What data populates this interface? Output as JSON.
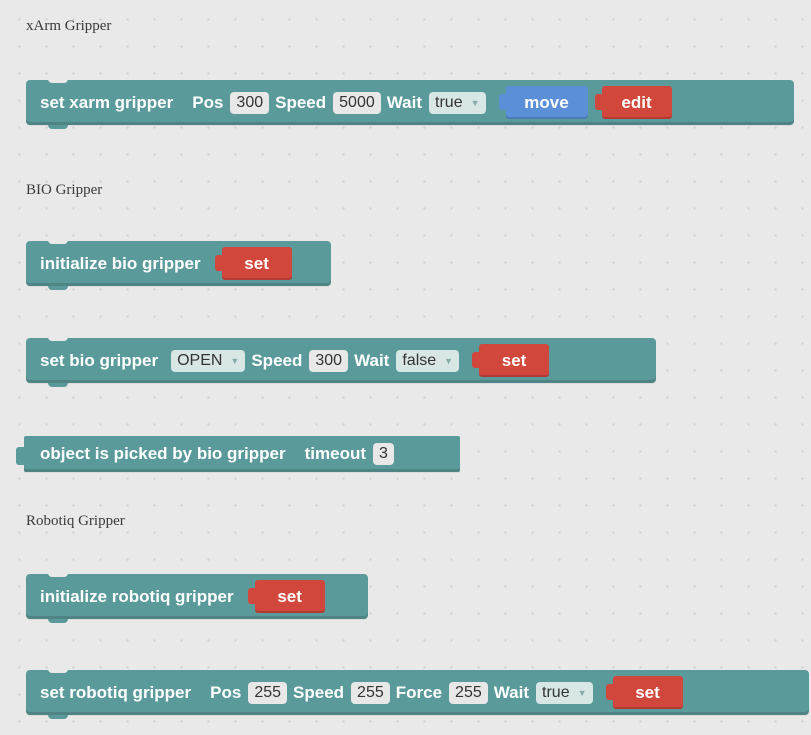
{
  "sections": {
    "xarm": "xArm Gripper",
    "bio": "BIO Gripper",
    "robotiq": "Robotiq Gripper"
  },
  "xarm_block": {
    "label": "set xarm gripper",
    "pos_label": "Pos",
    "pos_value": "300",
    "speed_label": "Speed",
    "speed_value": "5000",
    "wait_label": "Wait",
    "wait_value": "true",
    "move_button": "move",
    "edit_button": "edit"
  },
  "bio_init_block": {
    "label": "initialize bio gripper",
    "set_button": "set"
  },
  "bio_set_block": {
    "label": "set bio gripper",
    "state_value": "OPEN",
    "speed_label": "Speed",
    "speed_value": "300",
    "wait_label": "Wait",
    "wait_value": "false",
    "set_button": "set"
  },
  "bio_picked_block": {
    "label": "object is picked by bio gripper",
    "timeout_label": "timeout",
    "timeout_value": "3"
  },
  "robotiq_init_block": {
    "label": "initialize robotiq gripper",
    "set_button": "set"
  },
  "robotiq_set_block": {
    "label": "set robotiq gripper",
    "pos_label": "Pos",
    "pos_value": "255",
    "speed_label": "Speed",
    "speed_value": "255",
    "force_label": "Force",
    "force_value": "255",
    "wait_label": "Wait",
    "wait_value": "true",
    "set_button": "set"
  },
  "colors": {
    "block": "#5b9a9a",
    "button_blue": "#5b8fd8",
    "button_red": "#d2473c",
    "workspace": "#e9e9e9"
  },
  "icons": {
    "dropdown": "triangle-down-icon"
  }
}
